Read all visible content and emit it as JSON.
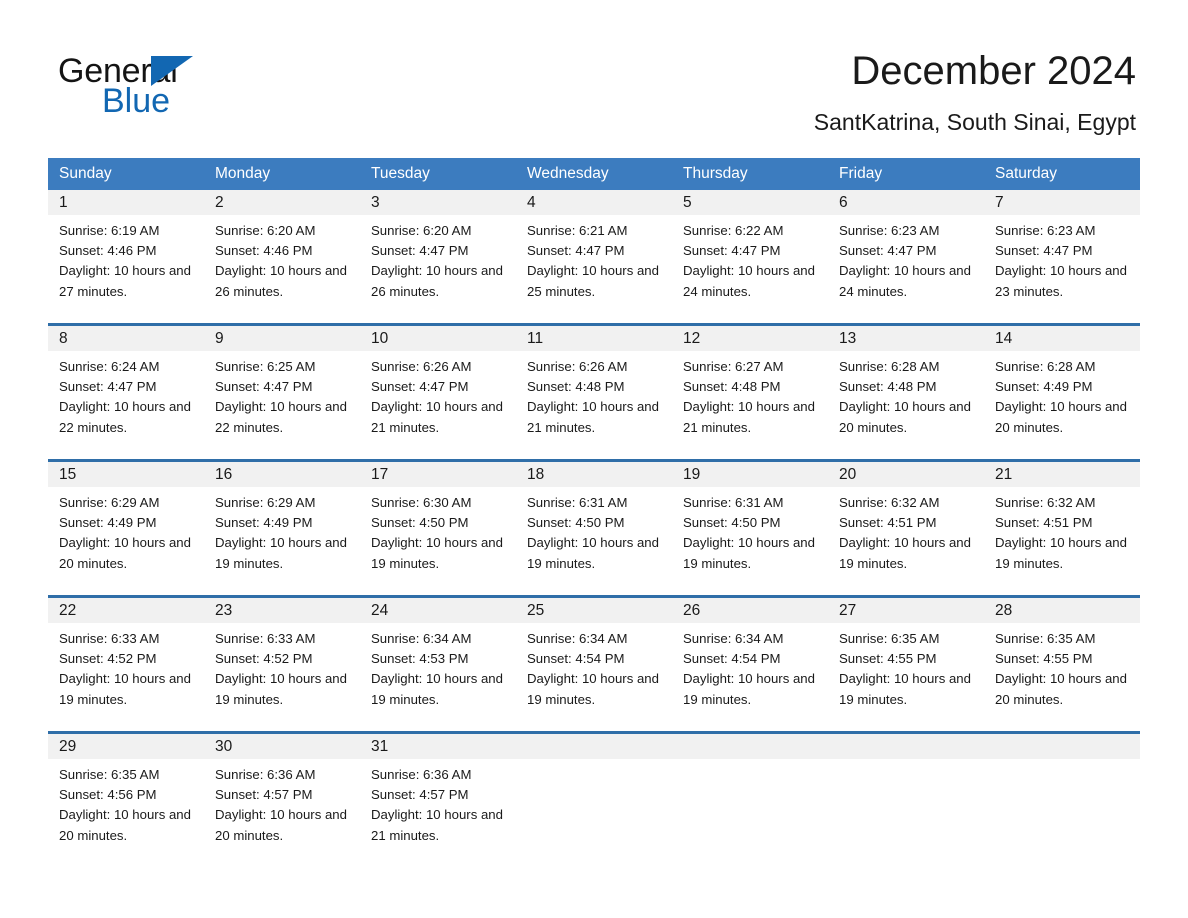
{
  "brand": {
    "name_part1": "General",
    "name_part2": "Blue",
    "accent_color": "#1267b2"
  },
  "header": {
    "title": "December 2024",
    "subtitle": "SantKatrina, South Sinai, Egypt"
  },
  "theme": {
    "header_row_bg": "#3c7cbf",
    "week_divider": "#2f6ea8",
    "day_number_bg": "#f1f1f1"
  },
  "weekdays": [
    "Sunday",
    "Monday",
    "Tuesday",
    "Wednesday",
    "Thursday",
    "Friday",
    "Saturday"
  ],
  "labels": {
    "sunrise_prefix": "Sunrise:",
    "sunset_prefix": "Sunset:",
    "daylight_prefix": "Daylight:"
  },
  "weeks": [
    [
      {
        "day": "1",
        "sunrise": "Sunrise: 6:19 AM",
        "sunset": "Sunset: 4:46 PM",
        "daylight": "Daylight: 10 hours and 27 minutes."
      },
      {
        "day": "2",
        "sunrise": "Sunrise: 6:20 AM",
        "sunset": "Sunset: 4:46 PM",
        "daylight": "Daylight: 10 hours and 26 minutes."
      },
      {
        "day": "3",
        "sunrise": "Sunrise: 6:20 AM",
        "sunset": "Sunset: 4:47 PM",
        "daylight": "Daylight: 10 hours and 26 minutes."
      },
      {
        "day": "4",
        "sunrise": "Sunrise: 6:21 AM",
        "sunset": "Sunset: 4:47 PM",
        "daylight": "Daylight: 10 hours and 25 minutes."
      },
      {
        "day": "5",
        "sunrise": "Sunrise: 6:22 AM",
        "sunset": "Sunset: 4:47 PM",
        "daylight": "Daylight: 10 hours and 24 minutes."
      },
      {
        "day": "6",
        "sunrise": "Sunrise: 6:23 AM",
        "sunset": "Sunset: 4:47 PM",
        "daylight": "Daylight: 10 hours and 24 minutes."
      },
      {
        "day": "7",
        "sunrise": "Sunrise: 6:23 AM",
        "sunset": "Sunset: 4:47 PM",
        "daylight": "Daylight: 10 hours and 23 minutes."
      }
    ],
    [
      {
        "day": "8",
        "sunrise": "Sunrise: 6:24 AM",
        "sunset": "Sunset: 4:47 PM",
        "daylight": "Daylight: 10 hours and 22 minutes."
      },
      {
        "day": "9",
        "sunrise": "Sunrise: 6:25 AM",
        "sunset": "Sunset: 4:47 PM",
        "daylight": "Daylight: 10 hours and 22 minutes."
      },
      {
        "day": "10",
        "sunrise": "Sunrise: 6:26 AM",
        "sunset": "Sunset: 4:47 PM",
        "daylight": "Daylight: 10 hours and 21 minutes."
      },
      {
        "day": "11",
        "sunrise": "Sunrise: 6:26 AM",
        "sunset": "Sunset: 4:48 PM",
        "daylight": "Daylight: 10 hours and 21 minutes."
      },
      {
        "day": "12",
        "sunrise": "Sunrise: 6:27 AM",
        "sunset": "Sunset: 4:48 PM",
        "daylight": "Daylight: 10 hours and 21 minutes."
      },
      {
        "day": "13",
        "sunrise": "Sunrise: 6:28 AM",
        "sunset": "Sunset: 4:48 PM",
        "daylight": "Daylight: 10 hours and 20 minutes."
      },
      {
        "day": "14",
        "sunrise": "Sunrise: 6:28 AM",
        "sunset": "Sunset: 4:49 PM",
        "daylight": "Daylight: 10 hours and 20 minutes."
      }
    ],
    [
      {
        "day": "15",
        "sunrise": "Sunrise: 6:29 AM",
        "sunset": "Sunset: 4:49 PM",
        "daylight": "Daylight: 10 hours and 20 minutes."
      },
      {
        "day": "16",
        "sunrise": "Sunrise: 6:29 AM",
        "sunset": "Sunset: 4:49 PM",
        "daylight": "Daylight: 10 hours and 19 minutes."
      },
      {
        "day": "17",
        "sunrise": "Sunrise: 6:30 AM",
        "sunset": "Sunset: 4:50 PM",
        "daylight": "Daylight: 10 hours and 19 minutes."
      },
      {
        "day": "18",
        "sunrise": "Sunrise: 6:31 AM",
        "sunset": "Sunset: 4:50 PM",
        "daylight": "Daylight: 10 hours and 19 minutes."
      },
      {
        "day": "19",
        "sunrise": "Sunrise: 6:31 AM",
        "sunset": "Sunset: 4:50 PM",
        "daylight": "Daylight: 10 hours and 19 minutes."
      },
      {
        "day": "20",
        "sunrise": "Sunrise: 6:32 AM",
        "sunset": "Sunset: 4:51 PM",
        "daylight": "Daylight: 10 hours and 19 minutes."
      },
      {
        "day": "21",
        "sunrise": "Sunrise: 6:32 AM",
        "sunset": "Sunset: 4:51 PM",
        "daylight": "Daylight: 10 hours and 19 minutes."
      }
    ],
    [
      {
        "day": "22",
        "sunrise": "Sunrise: 6:33 AM",
        "sunset": "Sunset: 4:52 PM",
        "daylight": "Daylight: 10 hours and 19 minutes."
      },
      {
        "day": "23",
        "sunrise": "Sunrise: 6:33 AM",
        "sunset": "Sunset: 4:52 PM",
        "daylight": "Daylight: 10 hours and 19 minutes."
      },
      {
        "day": "24",
        "sunrise": "Sunrise: 6:34 AM",
        "sunset": "Sunset: 4:53 PM",
        "daylight": "Daylight: 10 hours and 19 minutes."
      },
      {
        "day": "25",
        "sunrise": "Sunrise: 6:34 AM",
        "sunset": "Sunset: 4:54 PM",
        "daylight": "Daylight: 10 hours and 19 minutes."
      },
      {
        "day": "26",
        "sunrise": "Sunrise: 6:34 AM",
        "sunset": "Sunset: 4:54 PM",
        "daylight": "Daylight: 10 hours and 19 minutes."
      },
      {
        "day": "27",
        "sunrise": "Sunrise: 6:35 AM",
        "sunset": "Sunset: 4:55 PM",
        "daylight": "Daylight: 10 hours and 19 minutes."
      },
      {
        "day": "28",
        "sunrise": "Sunrise: 6:35 AM",
        "sunset": "Sunset: 4:55 PM",
        "daylight": "Daylight: 10 hours and 20 minutes."
      }
    ],
    [
      {
        "day": "29",
        "sunrise": "Sunrise: 6:35 AM",
        "sunset": "Sunset: 4:56 PM",
        "daylight": "Daylight: 10 hours and 20 minutes."
      },
      {
        "day": "30",
        "sunrise": "Sunrise: 6:36 AM",
        "sunset": "Sunset: 4:57 PM",
        "daylight": "Daylight: 10 hours and 20 minutes."
      },
      {
        "day": "31",
        "sunrise": "Sunrise: 6:36 AM",
        "sunset": "Sunset: 4:57 PM",
        "daylight": "Daylight: 10 hours and 21 minutes."
      },
      {
        "day": "",
        "sunrise": "",
        "sunset": "",
        "daylight": ""
      },
      {
        "day": "",
        "sunrise": "",
        "sunset": "",
        "daylight": ""
      },
      {
        "day": "",
        "sunrise": "",
        "sunset": "",
        "daylight": ""
      },
      {
        "day": "",
        "sunrise": "",
        "sunset": "",
        "daylight": ""
      }
    ]
  ]
}
